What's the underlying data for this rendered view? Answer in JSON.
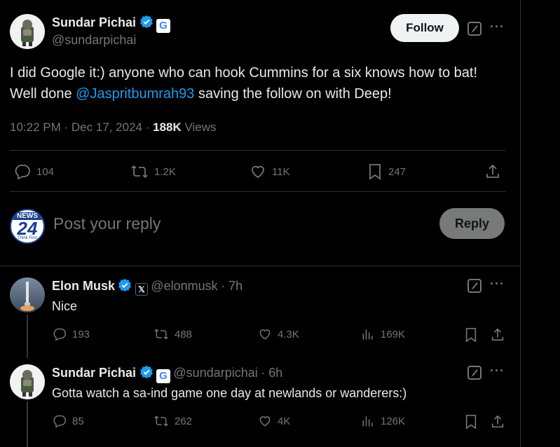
{
  "main_post": {
    "author_name": "Sundar Pichai",
    "handle": "@sundarpichai",
    "follow_label": "Follow",
    "text_before": "I did Google it:) anyone who can hook Cummins for a six knows how to bat! Well done ",
    "mention": "@Jaspritbumrah93",
    "text_after": " saving the follow on with Deep!",
    "time": "10:22 PM · Dec 17, 2024 · ",
    "views_count": "188K",
    "views_label": " Views",
    "stats": {
      "replies": "104",
      "reposts": "1.2K",
      "likes": "11K",
      "bookmarks": "247"
    }
  },
  "composer": {
    "avatar_text_top": "NEWS",
    "avatar_text_mid": "24",
    "avatar_text_bot": "Think First",
    "placeholder": "Post your reply",
    "reply_label": "Reply"
  },
  "replies": [
    {
      "author_name": "Elon Musk",
      "badge": "𝕏",
      "handle": "@elonmusk",
      "time": "· 7h",
      "text": "Nice",
      "stats": {
        "replies": "193",
        "reposts": "488",
        "likes": "4.3K",
        "views": "169K"
      }
    },
    {
      "author_name": "Sundar Pichai",
      "handle": "@sundarpichai",
      "time": "· 6h",
      "text": "Gotta watch a sa-ind game one day at newlands or wanderers:)",
      "stats": {
        "replies": "85",
        "reposts": "262",
        "likes": "4K",
        "views": "126K"
      }
    }
  ],
  "colors": {
    "accent": "#1d9bf0",
    "verified": "#1d9bf0",
    "muted": "#71767b"
  },
  "icons": [
    "verified-icon",
    "google-badge-icon",
    "grok-icon",
    "more-icon",
    "reply-icon",
    "repost-icon",
    "like-icon",
    "bookmark-icon",
    "share-icon",
    "views-icon"
  ]
}
